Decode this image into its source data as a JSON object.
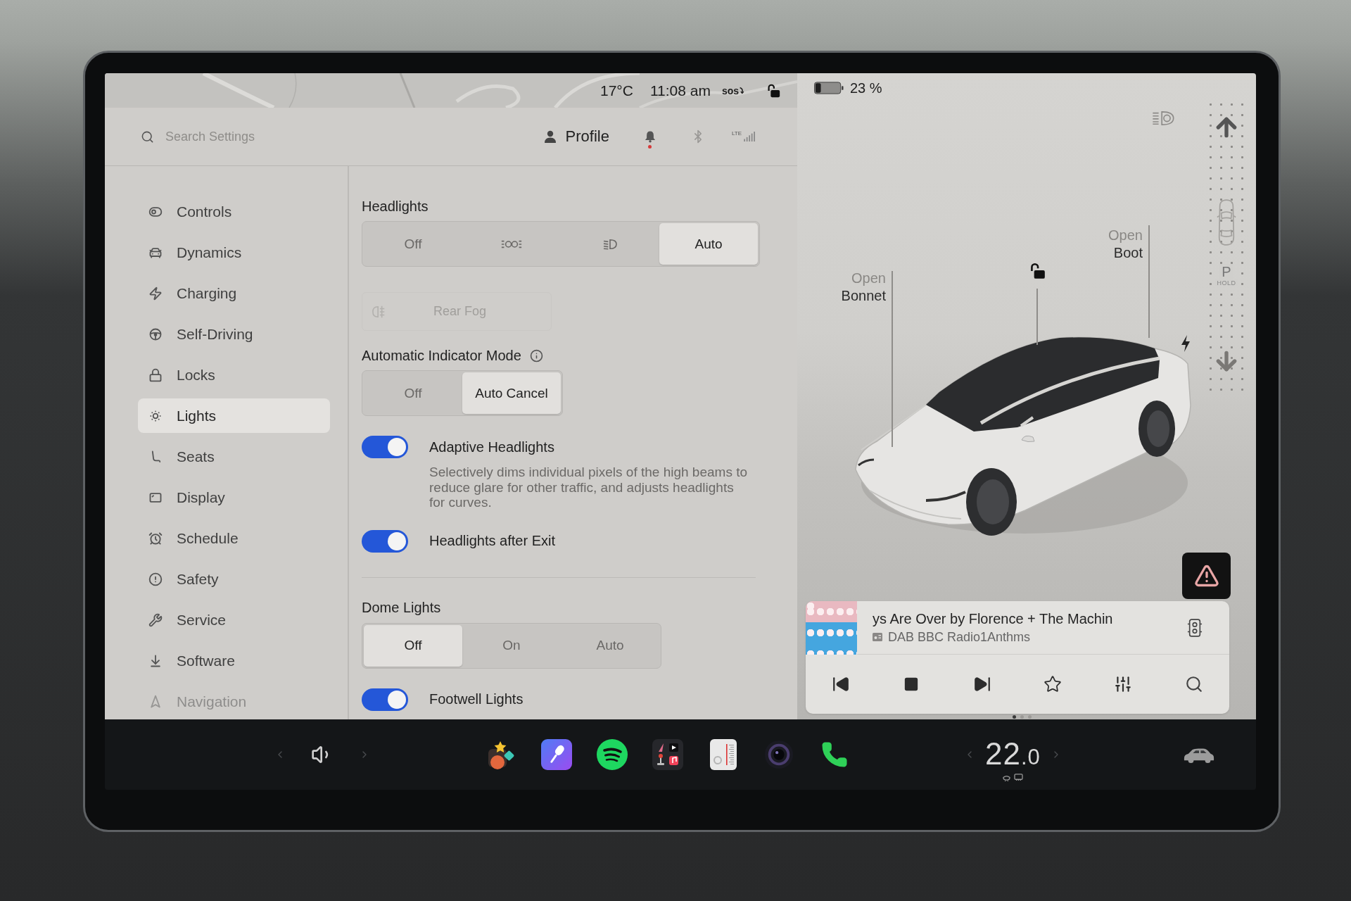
{
  "status_bar": {
    "temperature": "17°C",
    "time": "11:08 am",
    "sos": "sos",
    "locked": false
  },
  "search": {
    "placeholder": "Search Settings"
  },
  "header": {
    "profile": "Profile",
    "unread": true,
    "network": "LTE"
  },
  "sidebar": {
    "items": [
      {
        "label": "Controls",
        "selected": false
      },
      {
        "label": "Dynamics",
        "selected": false
      },
      {
        "label": "Charging",
        "selected": false
      },
      {
        "label": "Self-Driving",
        "selected": false
      },
      {
        "label": "Locks",
        "selected": false
      },
      {
        "label": "Lights",
        "selected": true
      },
      {
        "label": "Seats",
        "selected": false
      },
      {
        "label": "Display",
        "selected": false
      },
      {
        "label": "Schedule",
        "selected": false
      },
      {
        "label": "Safety",
        "selected": false
      },
      {
        "label": "Service",
        "selected": false
      },
      {
        "label": "Software",
        "selected": false
      },
      {
        "label": "Navigation",
        "selected": false
      }
    ]
  },
  "settings": [
    {
      "kind": "segmented",
      "title": "Headlights",
      "options": [
        {
          "kind": "text",
          "label": "Off",
          "selected": false
        },
        {
          "kind": "parking",
          "selected": false
        },
        {
          "kind": "lowbeam",
          "selected": false
        },
        {
          "kind": "text",
          "label": "Auto",
          "selected": true
        }
      ]
    },
    {
      "kind": "button",
      "label": "Rear Fog",
      "disabled": true
    },
    {
      "kind": "segmented",
      "title": "Automatic Indicator Mode",
      "info": true,
      "options": [
        {
          "kind": "text",
          "label": "Off",
          "selected": false
        },
        {
          "kind": "text",
          "label": "Auto Cancel",
          "selected": true
        }
      ]
    },
    {
      "kind": "toggle",
      "label": "Adaptive Headlights",
      "on": true,
      "description": "Selectively dims individual pixels of the high beams to reduce glare for other traffic, and adjusts headlights for curves."
    },
    {
      "kind": "toggle",
      "label": "Headlights after Exit",
      "on": true
    },
    {
      "kind": "divider"
    },
    {
      "kind": "segmented",
      "title": "Dome Lights",
      "options": [
        {
          "kind": "text",
          "label": "Off",
          "selected": true
        },
        {
          "kind": "text",
          "label": "On",
          "selected": false
        },
        {
          "kind": "text",
          "label": "Auto",
          "selected": false
        }
      ]
    },
    {
      "kind": "toggle",
      "label": "Footwell Lights",
      "on": true
    }
  ],
  "vehicle": {
    "battery": "23 %",
    "callouts": [
      {
        "verb": "Open",
        "part": "Bonnet"
      },
      {
        "verb": "Open",
        "part": "Boot"
      }
    ],
    "locked": false,
    "charging": true,
    "gear": "P",
    "gear_mode": "HOLD"
  },
  "media": {
    "title": "ys Are Over by Florence + The Machin",
    "station": "DAB BBC Radio1Anthms",
    "favorite": false,
    "pages": [
      {
        "selected": true
      },
      {
        "selected": false
      },
      {
        "selected": false
      }
    ]
  },
  "dock": {
    "temperature": "22",
    "temperature_decimal": ".0"
  }
}
